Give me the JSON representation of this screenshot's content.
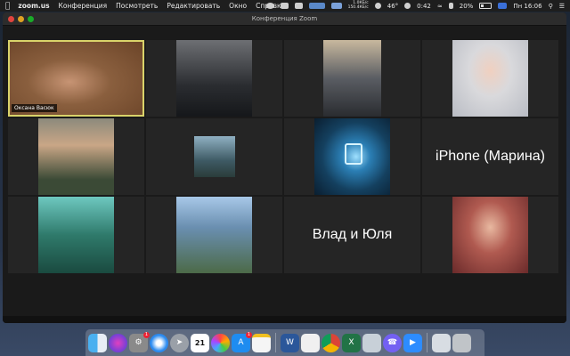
{
  "menubar": {
    "app_name": "zoom.us",
    "items": [
      "Конференция",
      "Посмотреть",
      "Редактировать",
      "Окно",
      "Справка"
    ],
    "net_up": "1.0КБ/с",
    "net_down": "150.4КБ/с",
    "temperature": "46°",
    "timer": "0:42",
    "battery": "20%",
    "clock": "Пн 16:06"
  },
  "window": {
    "title": "Конференция Zoom"
  },
  "participants": [
    {
      "name": "Оксана Васюк",
      "bg": "#8a5f3e",
      "active": true
    },
    {
      "name": "",
      "bg": "#3b3f44"
    },
    {
      "name": "",
      "bg": "#4a4d52"
    },
    {
      "name": "",
      "bg": "#b9bcc4"
    },
    {
      "name": "",
      "bg": "#4b5a46"
    },
    {
      "name": "",
      "bg": "#4e6a72"
    },
    {
      "name": "",
      "bg": "#1c4f7a"
    },
    {
      "label": "iPhone (Марина)"
    },
    {
      "name": "",
      "bg": "#2f7a6b"
    },
    {
      "name": "",
      "bg": "#6a8fb0"
    },
    {
      "label": "Влад и Юля"
    },
    {
      "name": "",
      "bg": "#8c3b3b"
    }
  ],
  "dock": {
    "calendar_day": "21",
    "badges": {
      "sysprefs": "1",
      "appstore": "1"
    }
  }
}
